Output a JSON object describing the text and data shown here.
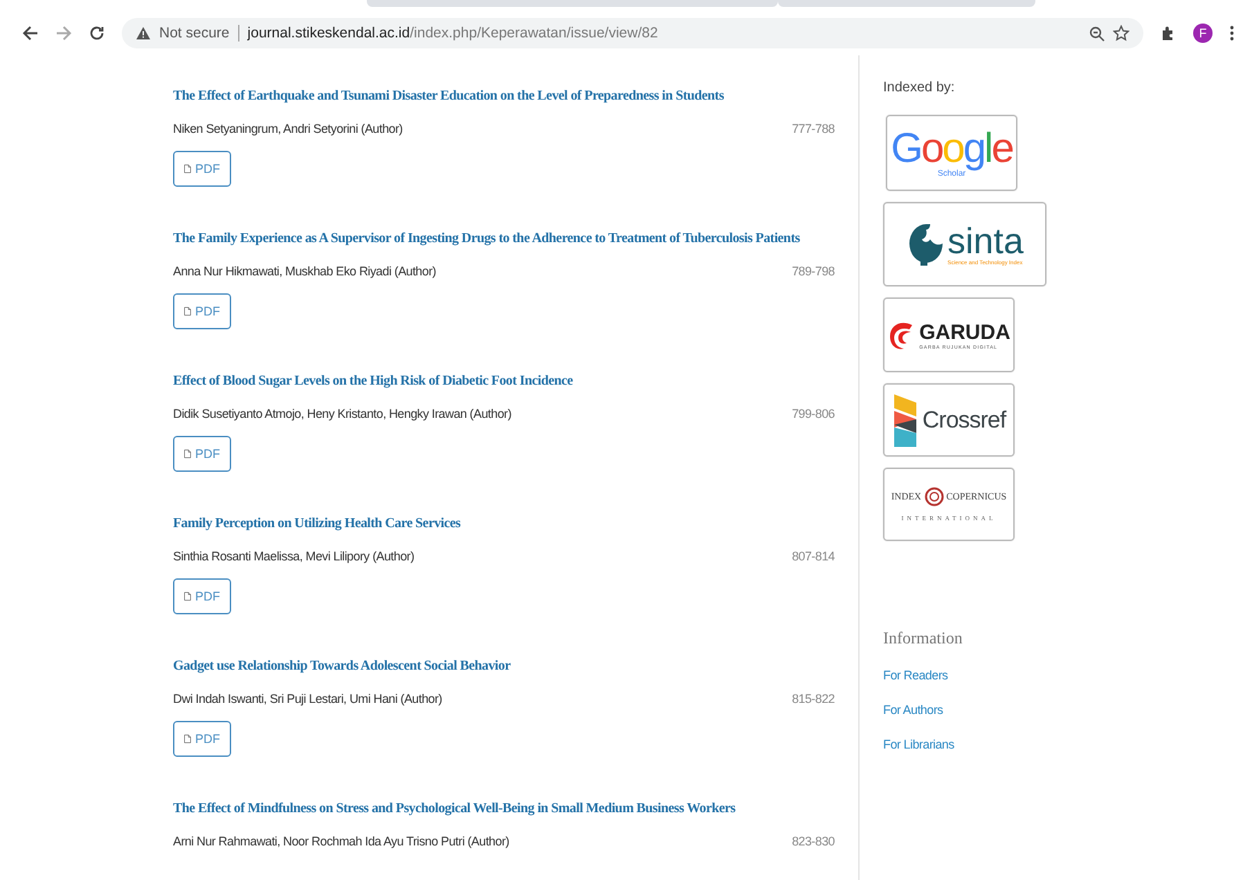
{
  "browser": {
    "security": "Not secure",
    "url_host": "journal.stikeskendal.ac.id",
    "url_path": "/index.php/Keperawatan/issue/view/82",
    "avatar": "F"
  },
  "articles": [
    {
      "title": "The Effect of Earthquake and Tsunami Disaster Education on the Level of Preparedness in Students",
      "authors": "Niken Setyaningrum, Andri Setyorini (Author)",
      "pages": "777-788",
      "pdf": "PDF"
    },
    {
      "title": "The Family Experience as A Supervisor of Ingesting Drugs to the Adherence to Treatment of Tuberculosis Patients",
      "authors": "Anna Nur Hikmawati, Muskhab Eko Riyadi (Author)",
      "pages": "789-798",
      "pdf": "PDF"
    },
    {
      "title": "Effect of Blood Sugar Levels on the High Risk of Diabetic Foot Incidence",
      "authors": "Didik Susetiyanto Atmojo, Heny Kristanto, Hengky Irawan (Author)",
      "pages": "799-806",
      "pdf": "PDF"
    },
    {
      "title": "Family Perception on Utilizing Health Care Services",
      "authors": "Sinthia Rosanti Maelissa, Mevi Lilipory (Author)",
      "pages": "807-814",
      "pdf": "PDF"
    },
    {
      "title": "Gadget use Relationship Towards Adolescent Social Behavior",
      "authors": "Dwi Indah Iswanti, Sri Puji Lestari, Umi Hani (Author)",
      "pages": "815-822",
      "pdf": "PDF"
    },
    {
      "title": "The Effect of Mindfulness on Stress and Psychological Well-Being in Small Medium Business Workers",
      "authors": "Arni Nur Rahmawati, Noor Rochmah Ida Ayu Trisno Putri (Author)",
      "pages": "823-830"
    }
  ],
  "sidebar": {
    "indexed_heading": "Indexed by:",
    "indexers": [
      {
        "kind": "google",
        "name": "Google",
        "sub": "Scholar"
      },
      {
        "kind": "sinta",
        "name": "sinta",
        "sub": "Science and Technology Index"
      },
      {
        "kind": "garuda",
        "name": "GARUDA",
        "sub": "GARBA RUJUKAN DIGITAL"
      },
      {
        "kind": "crossref",
        "name": "Crossref"
      },
      {
        "kind": "copernicus",
        "name": "INDEX",
        "name2": "COPERNICUS",
        "sub": "INTERNATIONAL"
      }
    ],
    "info_heading": "Information",
    "info_links": [
      "For Readers",
      "For Authors",
      "For Librarians"
    ]
  }
}
